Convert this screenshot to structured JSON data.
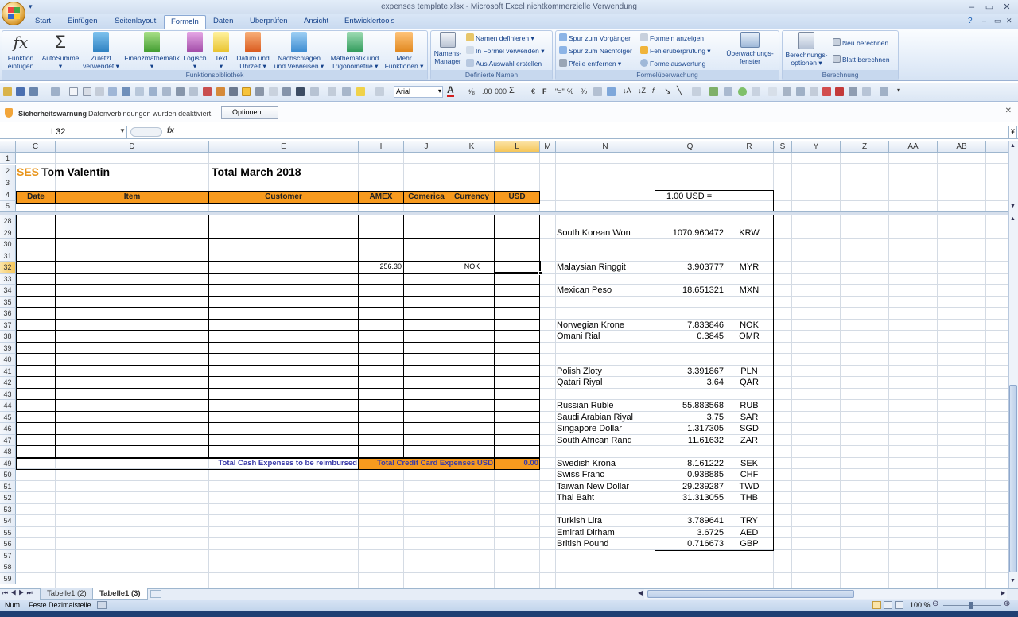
{
  "window": {
    "title": "expenses template.xlsx - Microsoft Excel nichtkommerzielle Verwendung"
  },
  "tabs": [
    "Start",
    "Einfügen",
    "Seitenlayout",
    "Formeln",
    "Daten",
    "Überprüfen",
    "Ansicht",
    "Entwicklertools"
  ],
  "active_tab": "Formeln",
  "ribbon": {
    "groups": {
      "funktionsbibliothek": "Funktionsbibliothek",
      "definierte_namen": "Definierte Namen",
      "formelueberwachung": "Formelüberwachung",
      "berechnung": "Berechnung"
    },
    "funktion_einfuegen": [
      "Funktion",
      "einfügen"
    ],
    "autosumme": [
      "AutoSumme",
      "▾"
    ],
    "zuletzt_verwendet": [
      "Zuletzt",
      "verwendet ▾"
    ],
    "finanzmathematik": [
      "Finanzmathematik",
      "▾"
    ],
    "logisch": [
      "Logisch",
      "▾"
    ],
    "text": [
      "Text",
      "▾"
    ],
    "datum_uhrzeit": [
      "Datum und",
      "Uhrzeit ▾"
    ],
    "nachschlagen": [
      "Nachschlagen",
      "und Verweisen ▾"
    ],
    "mathematik": [
      "Mathematik und",
      "Trigonometrie ▾"
    ],
    "mehr_funktionen": [
      "Mehr",
      "Funktionen ▾"
    ],
    "namens_manager": [
      "Namens-",
      "Manager"
    ],
    "namen_definieren": "Namen definieren ▾",
    "in_formel_verwenden": "In Formel verwenden ▾",
    "aus_auswahl_erstellen": "Aus Auswahl erstellen",
    "spur_vorgaenger": "Spur zum Vorgänger",
    "spur_nachfolger": "Spur zum Nachfolger",
    "pfeile_entfernen": "Pfeile entfernen ▾",
    "formeln_anzeigen": "Formeln anzeigen",
    "fehlerueberpruefung": "Fehlerüberprüfung ▾",
    "formelauswertung": "Formelauswertung",
    "ueberwachungsfenster": [
      "Überwachungs-",
      "fenster"
    ],
    "berechnungsoptionen": [
      "Berechnungs-",
      "optionen ▾"
    ],
    "neu_berechnen": "Neu berechnen",
    "blatt_berechnen": "Blatt berechnen"
  },
  "toolbar": {
    "font_name": "Arial"
  },
  "security_bar": {
    "title": "Sicherheitswarnung",
    "message": "Datenverbindungen wurden deaktiviert.",
    "options_button": "Optionen..."
  },
  "formula_bar": {
    "name_box": "L32",
    "fx": "fx",
    "content": ""
  },
  "columns": [
    "C",
    "D",
    "E",
    "I",
    "J",
    "K",
    "L",
    "M",
    "N",
    "Q",
    "R",
    "S",
    "Y",
    "Z",
    "AA",
    "AB"
  ],
  "selected_column": "L",
  "selected_row": "32",
  "sheet": {
    "header_partial": "SES",
    "name": "Tom Valentin",
    "period": "Total March 2018",
    "table_headers": [
      "Date",
      "Item",
      "Customer",
      "AMEX",
      "Comerica",
      "Currency",
      "USD"
    ],
    "row32": {
      "amex": "256.30",
      "currency": "NOK"
    },
    "total_cash_label": "Total Cash Expenses to be reimbursed",
    "total_cc_label": "Total Credit Card Expenses USD",
    "total_cc_value": "0.00",
    "rate_header": "1.00 USD =",
    "rates": [
      {
        "row": "29",
        "name": "South Korean Won",
        "rate": "1070.960472",
        "code": "KRW"
      },
      {
        "row": "32",
        "name": "Malaysian Ringgit",
        "rate": "3.903777",
        "code": "MYR"
      },
      {
        "row": "34",
        "name": "Mexican Peso",
        "rate": "18.651321",
        "code": "MXN"
      },
      {
        "row": "37",
        "name": "Norwegian Krone",
        "rate": "7.833846",
        "code": "NOK"
      },
      {
        "row": "38",
        "name": "Omani Rial",
        "rate": "0.3845",
        "code": "OMR"
      },
      {
        "row": "41",
        "name": "Polish Zloty",
        "rate": "3.391867",
        "code": "PLN"
      },
      {
        "row": "42",
        "name": "Qatari Riyal",
        "rate": "3.64",
        "code": "QAR"
      },
      {
        "row": "44",
        "name": "Russian Ruble",
        "rate": "55.883568",
        "code": "RUB"
      },
      {
        "row": "45",
        "name": "Saudi Arabian Riyal",
        "rate": "3.75",
        "code": "SAR"
      },
      {
        "row": "46",
        "name": "Singapore Dollar",
        "rate": "1.317305",
        "code": "SGD"
      },
      {
        "row": "47",
        "name": "South African Rand",
        "rate": "11.61632",
        "code": "ZAR"
      },
      {
        "row": "49",
        "name": "Swedish Krona",
        "rate": "8.161222",
        "code": "SEK"
      },
      {
        "row": "50",
        "name": "Swiss Franc",
        "rate": "0.938885",
        "code": "CHF"
      },
      {
        "row": "51",
        "name": "Taiwan New Dollar",
        "rate": "29.239287",
        "code": "TWD"
      },
      {
        "row": "52",
        "name": "Thai Baht",
        "rate": "31.313055",
        "code": "THB"
      },
      {
        "row": "54",
        "name": "Turkish Lira",
        "rate": "3.789641",
        "code": "TRY"
      },
      {
        "row": "55",
        "name": "Emirati Dirham",
        "rate": "3.6725",
        "code": "AED"
      },
      {
        "row": "56",
        "name": "British Pound",
        "rate": "0.716673",
        "code": "GBP"
      }
    ]
  },
  "row_numbers": [
    "1",
    "2",
    "3",
    "4",
    "5",
    "28",
    "29",
    "30",
    "31",
    "32",
    "33",
    "34",
    "35",
    "36",
    "37",
    "38",
    "39",
    "40",
    "41",
    "42",
    "43",
    "44",
    "45",
    "46",
    "47",
    "48",
    "49",
    "50",
    "51",
    "52",
    "53",
    "54",
    "55",
    "56",
    "57",
    "58",
    "59"
  ],
  "sheet_tabs": [
    "Tabelle1 (2)",
    "Tabelle1 (3)"
  ],
  "active_sheet": "Tabelle1 (3)",
  "status": {
    "mode": "Num",
    "fixed_decimal": "Feste Dezimalstelle",
    "zoom": "100 %"
  },
  "colors": {
    "header_orange": "#f79a1e",
    "title_orange": "#e8951c",
    "link_blue": "#3a3aa8",
    "ribbon_text": "#15428b"
  }
}
